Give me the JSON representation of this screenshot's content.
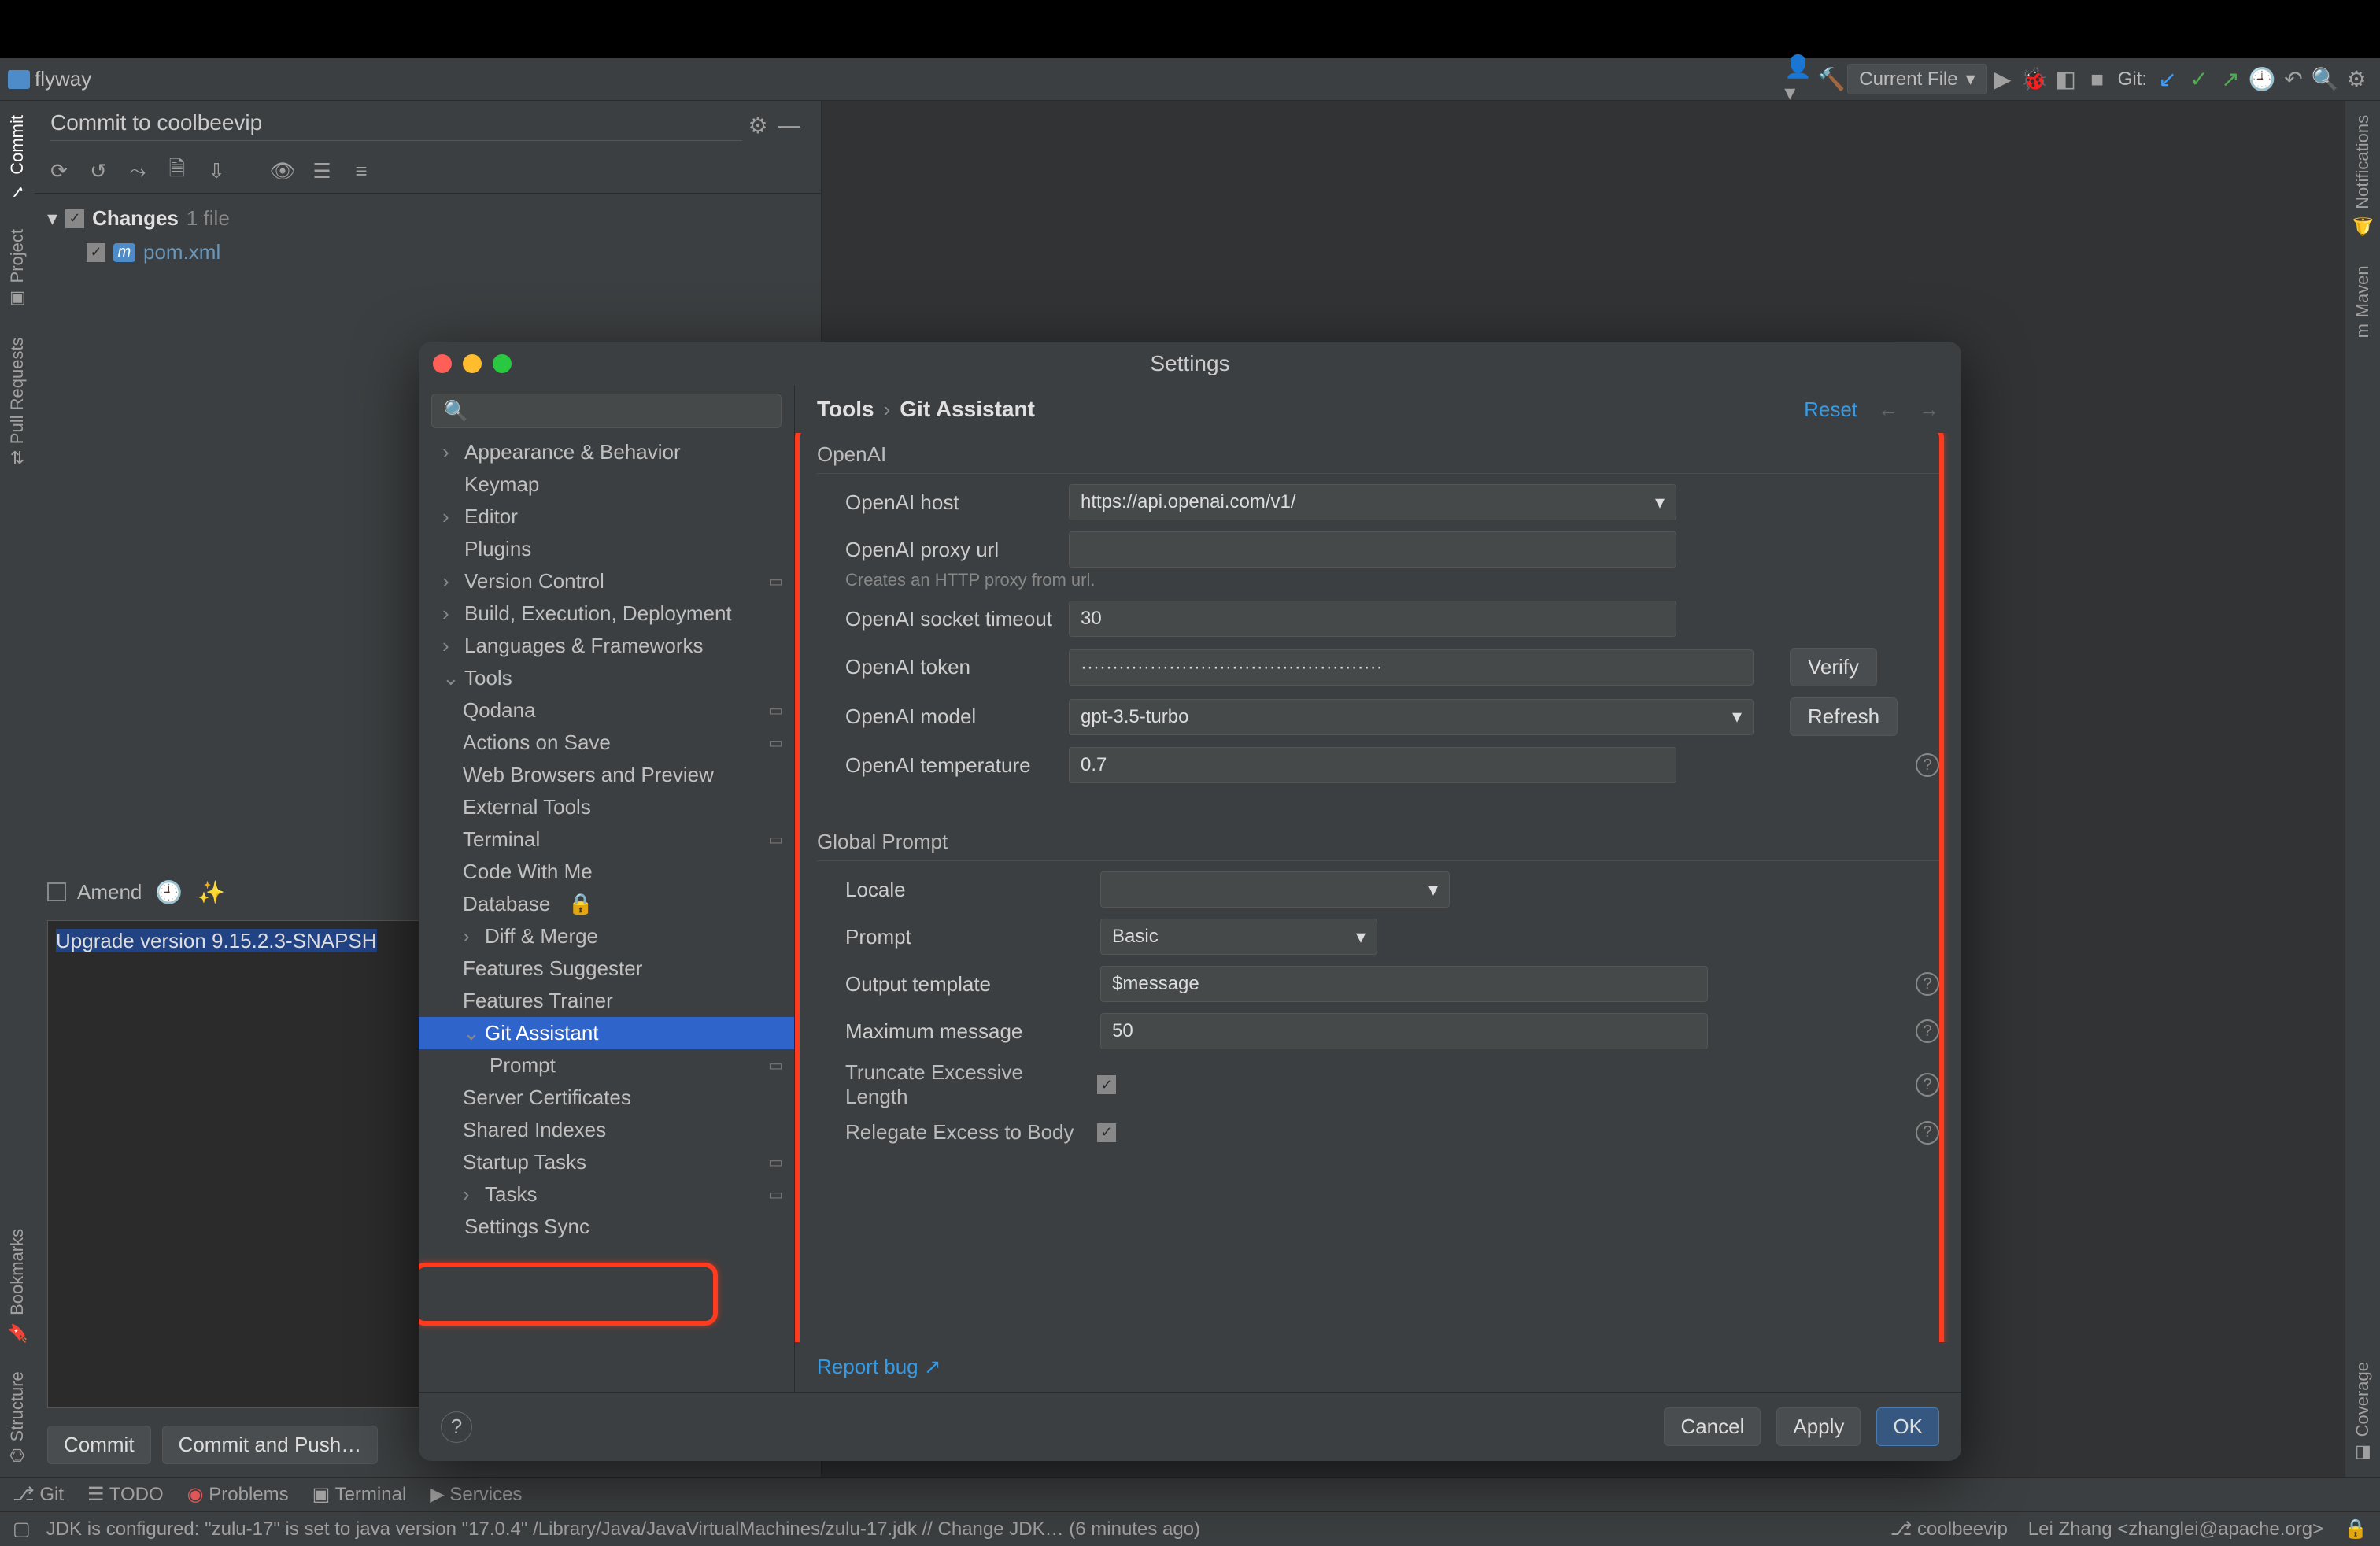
{
  "project": {
    "name": "flyway"
  },
  "toolbar": {
    "run_config": "Current File",
    "git_label": "Git:"
  },
  "commit_panel": {
    "title": "Commit to coolbeevip",
    "changes_label": "Changes",
    "changes_count": "1 file",
    "file1": "pom.xml",
    "amend_label": "Amend",
    "message": "Upgrade version 9.15.2.3-SNAPSH",
    "commit_btn": "Commit",
    "commit_push_btn": "Commit and Push…"
  },
  "left_strip": {
    "commit": "Commit",
    "project": "Project",
    "pull": "Pull Requests"
  },
  "right_strip": {
    "notifications": "Notifications",
    "maven": "Maven",
    "bookmarks": "Bookmarks",
    "structure": "Structure",
    "coverage": "Coverage"
  },
  "dialog": {
    "title": "Settings",
    "search_placeholder": "",
    "crumb_tools": "Tools",
    "crumb_git_assistant": "Git Assistant",
    "reset": "Reset",
    "tree": {
      "appearance": "Appearance & Behavior",
      "keymap": "Keymap",
      "editor": "Editor",
      "plugins": "Plugins",
      "version_control": "Version Control",
      "build": "Build, Execution, Deployment",
      "languages": "Languages & Frameworks",
      "tools": "Tools",
      "qodana": "Qodana",
      "actions_save": "Actions on Save",
      "web_browsers": "Web Browsers and Preview",
      "external_tools": "External Tools",
      "terminal": "Terminal",
      "code_with_me": "Code With Me",
      "database": "Database",
      "diff_merge": "Diff & Merge",
      "features_suggester": "Features Suggester",
      "features_trainer": "Features Trainer",
      "git_assistant": "Git Assistant",
      "prompt_item": "Prompt",
      "server_certs": "Server Certificates",
      "shared_indexes": "Shared Indexes",
      "startup_tasks": "Startup Tasks",
      "tasks": "Tasks",
      "settings_sync": "Settings Sync"
    },
    "form": {
      "section_openai": "OpenAI",
      "host_label": "OpenAI host",
      "host_value": "https://api.openai.com/v1/",
      "proxy_label": "OpenAI proxy url",
      "proxy_value": "",
      "proxy_hint": "Creates an HTTP proxy from url.",
      "timeout_label": "OpenAI socket timeout",
      "timeout_value": "30",
      "token_label": "OpenAI token",
      "token_value": "················································",
      "verify_btn": "Verify",
      "model_label": "OpenAI model",
      "model_value": "gpt-3.5-turbo",
      "refresh_btn": "Refresh",
      "temp_label": "OpenAI temperature",
      "temp_value": "0.7",
      "section_global": "Global Prompt",
      "locale_label": "Locale",
      "locale_value": "",
      "prompt_label": "Prompt",
      "prompt_value": "Basic",
      "output_label": "Output template",
      "output_value": "$message",
      "max_label": "Maximum message",
      "max_value": "50",
      "truncate_label": "Truncate Excessive Length",
      "relegate_label": "Relegate Excess to Body",
      "report_bug": "Report bug ↗"
    },
    "footer": {
      "cancel": "Cancel",
      "apply": "Apply",
      "ok": "OK"
    }
  },
  "bottom_tools": {
    "git": "Git",
    "todo": "TODO",
    "problems": "Problems",
    "terminal": "Terminal",
    "services": "Services"
  },
  "status": {
    "jdk": "JDK is configured: \"zulu-17\" is set to java version \"17.0.4\" /Library/Java/JavaVirtualMachines/zulu-17.jdk // Change JDK… (6 minutes ago)",
    "branch": "coolbeevip",
    "user": "Lei Zhang <zhanglei@apache.org>"
  }
}
